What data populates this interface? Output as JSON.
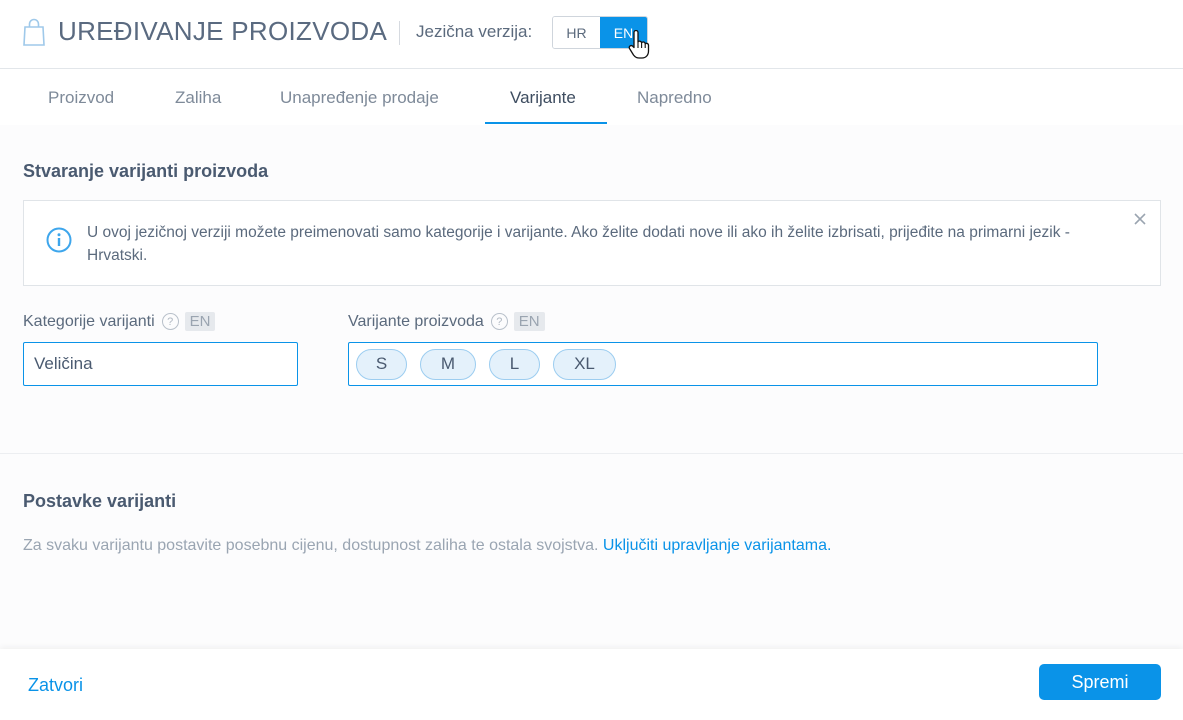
{
  "header": {
    "title": "UREĐIVANJE PROIZVODA",
    "language_label": "Jezična verzija:",
    "languages": [
      {
        "label": "HR",
        "active": false
      },
      {
        "label": "EN",
        "active": true
      }
    ]
  },
  "tabs": [
    {
      "label": "Proizvod",
      "active": false
    },
    {
      "label": "Zaliha",
      "active": false
    },
    {
      "label": "Unapređenje prodaje",
      "active": false
    },
    {
      "label": "Varijante",
      "active": true
    },
    {
      "label": "Napredno",
      "active": false
    }
  ],
  "variants_section": {
    "title": "Stvaranje varijanti proizvoda",
    "info_text": "U ovoj jezičnoj verziji možete preimenovati samo kategorije i varijante. Ako želite dodati nove ili ako ih želite izbrisati, prijeđite na primarni jezik - Hrvatski.",
    "category_label": "Kategorije varijanti",
    "category_lang_badge": "EN",
    "category_value": "Veličina",
    "variants_label": "Varijante proizvoda",
    "variants_lang_badge": "EN",
    "variant_tags": [
      "S",
      "M",
      "L",
      "XL"
    ]
  },
  "settings_section": {
    "title": "Postavke varijanti",
    "description": "Za svaku varijantu postavite posebnu cijenu, dostupnost zaliha te ostala svojstva.",
    "link_text": "Uključiti upravljanje varijantama."
  },
  "footer": {
    "close_label": "Zatvori",
    "save_label": "Spremi"
  },
  "colors": {
    "accent": "#0a93e8",
    "text": "#5b6a7d",
    "heading": "#4a5a70"
  }
}
